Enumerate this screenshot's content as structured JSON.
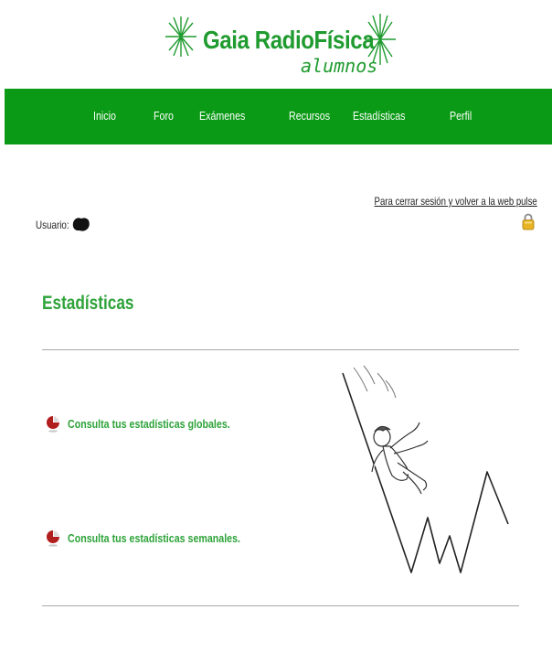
{
  "brand": {
    "title": "Gaia RadioFísica",
    "subtitle": "alumnos",
    "color": "#1f9b2f"
  },
  "nav": {
    "background": "#0a9a15",
    "items": [
      {
        "label": "Inicio"
      },
      {
        "label": "Foro"
      },
      {
        "label": "Exámenes"
      },
      {
        "label": "Recursos"
      },
      {
        "label": "Estadísticas"
      },
      {
        "label": "Perfil"
      }
    ]
  },
  "session": {
    "logout_text": "Para cerrar sesión y volver a la web pulse",
    "user_label": "Usuario:"
  },
  "main": {
    "title": "Estadísticas",
    "links": [
      {
        "label": "Consulta tus estadísticas globales."
      },
      {
        "label": "Consulta tus estadísticas semanales."
      }
    ]
  }
}
